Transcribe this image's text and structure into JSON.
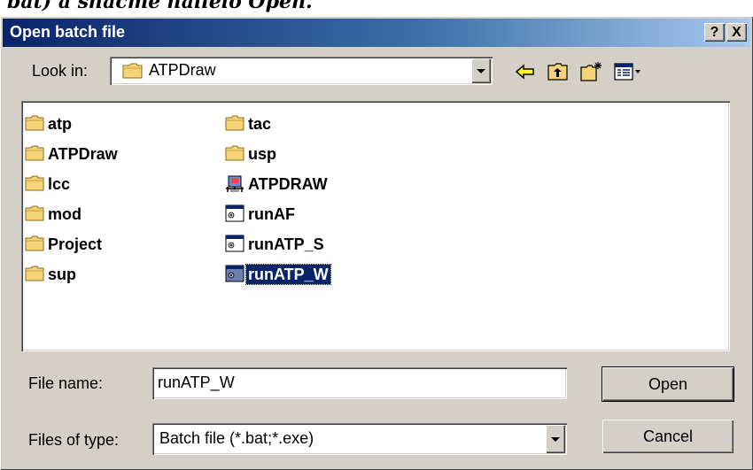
{
  "document": {
    "caption_fragment": "bat) a shacme hallelo Open."
  },
  "window": {
    "title": "Open batch file",
    "help_button": "?",
    "close_button": "X"
  },
  "look_in": {
    "label": "Look in:",
    "value": "ATPDraw",
    "icon": "folder-icon"
  },
  "toolbar": {
    "icons": [
      "back-arrow-icon",
      "up-one-level-icon",
      "create-new-folder-icon",
      "view-menu-icon"
    ]
  },
  "files": {
    "column1": [
      {
        "name": "atp",
        "type": "folder"
      },
      {
        "name": "ATPDraw",
        "type": "folder"
      },
      {
        "name": "lcc",
        "type": "folder"
      },
      {
        "name": "mod",
        "type": "folder"
      },
      {
        "name": "Project",
        "type": "folder"
      },
      {
        "name": "sup",
        "type": "folder"
      }
    ],
    "column2": [
      {
        "name": "tac",
        "type": "folder"
      },
      {
        "name": "usp",
        "type": "folder"
      },
      {
        "name": "ATPDRAW",
        "type": "application"
      },
      {
        "name": "runAF",
        "type": "batch"
      },
      {
        "name": "runATP_S",
        "type": "batch"
      },
      {
        "name": "runATP_W",
        "type": "batch",
        "selected": true
      }
    ]
  },
  "file_name": {
    "label": "File name:",
    "value": "runATP_W"
  },
  "files_of_type": {
    "label": "Files of type:",
    "value": "Batch file (*.bat;*.exe)"
  },
  "buttons": {
    "open": "Open",
    "cancel": "Cancel"
  },
  "colors": {
    "title_bar": "#0a246a",
    "selection": "#0a246a",
    "folder": "#f5d376",
    "dialog_face": "#d4d0c8"
  }
}
